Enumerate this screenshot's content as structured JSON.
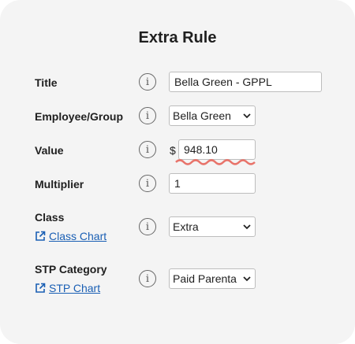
{
  "dialog": {
    "title": "Extra Rule"
  },
  "fields": {
    "title": {
      "label": "Title",
      "value": "Bella Green - GPPL"
    },
    "employee": {
      "label": "Employee/Group",
      "selected": "Bella Green"
    },
    "value": {
      "label": "Value",
      "currency": "$",
      "value": "948.10"
    },
    "multiplier": {
      "label": "Multiplier",
      "value": "1"
    },
    "class": {
      "label": "Class",
      "link": "Class Chart",
      "selected": "Extra"
    },
    "stp": {
      "label": "STP Category",
      "link": "STP Chart",
      "selected": "Paid Parenta"
    }
  },
  "icons": {
    "info": "info-icon",
    "external_link": "external-link-icon",
    "dropdown": "chevron-down-icon"
  },
  "colors": {
    "link": "#1a5fb4",
    "spellcheck": "#e8746b",
    "background": "#f4f4f4"
  },
  "info_glyph": "i"
}
